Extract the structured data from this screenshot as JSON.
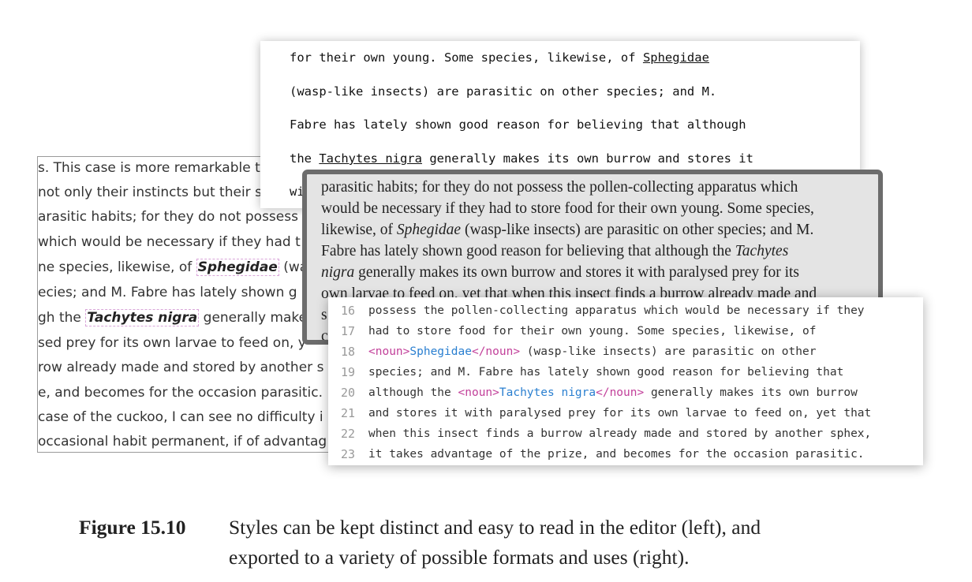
{
  "editor_left": {
    "lines": [
      {
        "pre": "s. This case is more remarkable t"
      },
      {
        "pre": "not only their instincts but their s"
      },
      {
        "pre": "arasitic habits; for they do not possess"
      },
      {
        "pre": "which would be necessary if they had t"
      },
      {
        "pre": "ne species, likewise, of ",
        "noun": "Sphegidae",
        "post": " (wa"
      },
      {
        "pre": "ecies; and M. Fabre has lately shown g"
      },
      {
        "pre": "gh the ",
        "noun": "Tachytes nigra",
        "post": " generally makes"
      },
      {
        "pre": "sed prey for its own larvae to feed on, y"
      },
      {
        "pre": "row already made and stored by another s"
      },
      {
        "pre": "e, and becomes for the occasion parasitic."
      },
      {
        "pre": "case of the cuckoo, I can see no difficulty i"
      },
      {
        "pre": "occasional habit permanent, if of advantag"
      }
    ]
  },
  "typewriter": {
    "lines": [
      {
        "pre": "for their own young. Some species, likewise, of ",
        "u": "Sphegidae",
        "post": ""
      },
      {
        "pre": "(wasp-like insects) are parasitic on other species; and M.",
        "u": "",
        "post": ""
      },
      {
        "pre": "Fabre has lately shown good reason for believing that although",
        "u": "",
        "post": ""
      },
      {
        "pre": "the ",
        "u": "Tachytes nigra",
        "post": " generally makes its own burrow and stores it"
      },
      {
        "pre": "wi",
        "u": "",
        "post": ""
      }
    ]
  },
  "book": {
    "lines": [
      {
        "pre": "parasitic habits; for they do not possess the pollen-collecting apparatus which",
        "it": "",
        "post": ""
      },
      {
        "pre": "would be necessary if they had to store food for their own young. Some species,",
        "it": "",
        "post": ""
      },
      {
        "pre": "likewise, of ",
        "it": "Sphegidae",
        "post": " (wasp-like insects) are parasitic on other species; and M."
      },
      {
        "pre": "Fabre has lately shown good reason for believing that although the ",
        "it": "Tachytes",
        "post": ""
      },
      {
        "pre": "",
        "it": "nigra",
        "post": " generally makes its own burrow and stores it with paralysed prey for its"
      },
      {
        "pre": "own larvae to feed on, yet that when this insect finds a burrow already made and",
        "it": "",
        "post": ""
      },
      {
        "pre": "s",
        "it": "",
        "post": ""
      },
      {
        "pre": "c",
        "it": "",
        "post": ""
      }
    ]
  },
  "code_editor": {
    "lines": [
      {
        "num": "16",
        "pre": "possess the pollen-collecting apparatus which would be necessary if they",
        "open": "",
        "token": "",
        "close": "",
        "post": ""
      },
      {
        "num": "17",
        "pre": "had to store food for their own young. Some species, likewise, of",
        "open": "",
        "token": "",
        "close": "",
        "post": ""
      },
      {
        "num": "18",
        "pre": "",
        "open": "<noun>",
        "token": "Sphegidae",
        "close": "</noun>",
        "post": " (wasp-like insects) are parasitic on other"
      },
      {
        "num": "19",
        "pre": "species; and M. Fabre has lately shown good reason for believing that",
        "open": "",
        "token": "",
        "close": "",
        "post": ""
      },
      {
        "num": "20",
        "pre": "although the ",
        "open": "<noun>",
        "token": "Tachytes nigra",
        "close": "</noun>",
        "post": " generally makes its own burrow"
      },
      {
        "num": "21",
        "pre": "and stores it with paralysed prey for its own larvae to feed on, yet that",
        "open": "",
        "token": "",
        "close": "",
        "post": ""
      },
      {
        "num": "22",
        "pre": "when this insect finds a burrow already made and stored by another sphex,",
        "open": "",
        "token": "",
        "close": "",
        "post": ""
      },
      {
        "num": "23",
        "pre": "it takes advantage of the prize, and becomes for the occasion parasitic.",
        "open": "",
        "token": "",
        "close": "",
        "post": ""
      }
    ]
  },
  "caption": {
    "label": "Figure 15.10",
    "line1": "Styles can be kept distinct and easy to read in the editor (left), and",
    "line2": "exported to a variety of possible formats and uses (right)."
  },
  "colors": {
    "noun_tag": "#c2409a",
    "noun_token": "#2a7fd0",
    "noun_highlight_border": "#d9a5d9"
  }
}
